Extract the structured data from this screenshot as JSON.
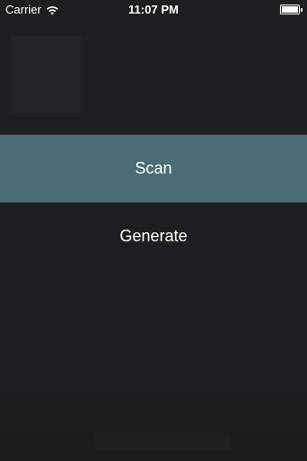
{
  "status_bar": {
    "carrier": "Carrier",
    "time": "11:07 PM",
    "wifi_icon": "wifi-icon",
    "battery_icon": "battery-icon"
  },
  "menu": {
    "items": [
      {
        "label": "Scan",
        "selected": true
      },
      {
        "label": "Generate",
        "selected": false
      }
    ]
  },
  "colors": {
    "background": "#1e1f22",
    "selected_row": "#4b6b75",
    "text": "#ffffff"
  }
}
